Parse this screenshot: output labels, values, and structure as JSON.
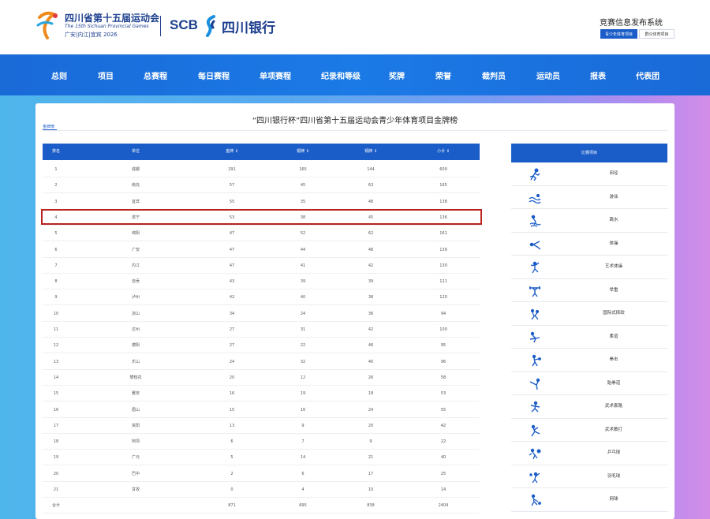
{
  "header": {
    "games_name_cn": "四川省第十五届运动会",
    "games_name_en": "The 15th Sichuan Provincial Games",
    "games_hosts": "广安|内江|宜宾 2026",
    "sponsor_latin": "SCB",
    "sponsor_cn": "四川银行",
    "system_title": "竞赛信息发布系统",
    "tabs": [
      "青少年体育项目",
      "群众体育项目"
    ],
    "accent_color": "#1a5cc8"
  },
  "nav": {
    "items": [
      "总则",
      "项目",
      "总赛程",
      "每日赛程",
      "单项赛程",
      "纪录和等级",
      "奖牌",
      "荣誉",
      "裁判员",
      "运动员",
      "报表",
      "代表团"
    ]
  },
  "page": {
    "title": "“四川银行杯”四川省第十五届运动会青少年体育项目金牌榜",
    "subtab": "金牌榜"
  },
  "table": {
    "headers": [
      "排名",
      "单位",
      "金牌 ↕",
      "银牌 ↕",
      "铜牌 ↕",
      "小计 ↕"
    ],
    "rows": [
      [
        "1",
        "成都",
        "291",
        "165",
        "144",
        "600"
      ],
      [
        "2",
        "南充",
        "57",
        "45",
        "63",
        "165"
      ],
      [
        "3",
        "宜宾",
        "55",
        "35",
        "48",
        "138"
      ],
      [
        "4",
        "遂宁",
        "53",
        "38",
        "45",
        "136"
      ],
      [
        "5",
        "绵阳",
        "47",
        "52",
        "62",
        "161"
      ],
      [
        "6",
        "广安",
        "47",
        "44",
        "48",
        "139"
      ],
      [
        "7",
        "内江",
        "47",
        "41",
        "42",
        "130"
      ],
      [
        "8",
        "自贡",
        "43",
        "39",
        "39",
        "121"
      ],
      [
        "9",
        "泸州",
        "42",
        "40",
        "38",
        "120"
      ],
      [
        "10",
        "凉山",
        "34",
        "24",
        "36",
        "94"
      ],
      [
        "11",
        "达州",
        "27",
        "31",
        "42",
        "100"
      ],
      [
        "12",
        "德阳",
        "27",
        "22",
        "46",
        "95"
      ],
      [
        "13",
        "乐山",
        "24",
        "32",
        "40",
        "96"
      ],
      [
        "14",
        "攀枝花",
        "20",
        "12",
        "26",
        "58"
      ],
      [
        "15",
        "雅安",
        "16",
        "19",
        "18",
        "53"
      ],
      [
        "16",
        "眉山",
        "15",
        "16",
        "24",
        "55"
      ],
      [
        "17",
        "资阳",
        "13",
        "9",
        "20",
        "42"
      ],
      [
        "18",
        "阿坝",
        "6",
        "7",
        "9",
        "22"
      ],
      [
        "19",
        "广元",
        "5",
        "14",
        "21",
        "40"
      ],
      [
        "20",
        "巴中",
        "2",
        "6",
        "17",
        "25"
      ],
      [
        "21",
        "甘孜",
        "0",
        "4",
        "10",
        "14"
      ]
    ],
    "total": [
      "合计",
      "",
      "871",
      "695",
      "838",
      "2404"
    ],
    "highlight_row": 4,
    "highlight_color": "#b8221f"
  },
  "sports": {
    "header": "比赛项目",
    "items": [
      {
        "label": "田径",
        "icon": "athletics-icon"
      },
      {
        "label": "游泳",
        "icon": "swimming-icon"
      },
      {
        "label": "跳水",
        "icon": "diving-icon"
      },
      {
        "label": "体操",
        "icon": "gymnastics-icon"
      },
      {
        "label": "艺术体操",
        "icon": "rhythmic-gymnastics-icon"
      },
      {
        "label": "举重",
        "icon": "weightlifting-icon"
      },
      {
        "label": "国际式摔跤",
        "icon": "wrestling-icon"
      },
      {
        "label": "柔道",
        "icon": "judo-icon"
      },
      {
        "label": "拳击",
        "icon": "boxing-icon"
      },
      {
        "label": "跆拳道",
        "icon": "taekwondo-icon"
      },
      {
        "label": "武术套路",
        "icon": "wushu-taolu-icon"
      },
      {
        "label": "武术散打",
        "icon": "wushu-sanda-icon"
      },
      {
        "label": "乒乓球",
        "icon": "table-tennis-icon"
      },
      {
        "label": "羽毛球",
        "icon": "badminton-icon"
      },
      {
        "label": "网球",
        "icon": "tennis-icon"
      }
    ]
  }
}
